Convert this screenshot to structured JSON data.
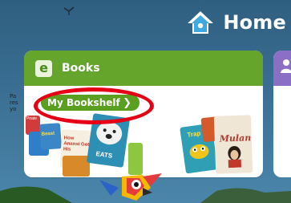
{
  "header": {
    "title": "Home",
    "icon": "home-icon"
  },
  "books_card": {
    "icon_letter": "e",
    "title": "Books",
    "button_label": "My Bookshelf",
    "button_icon": "chevron-right-icon",
    "covers": [
      {
        "title": "Pirate"
      },
      {
        "title": "Beast"
      },
      {
        "title": "How Anansi Got His"
      },
      {
        "title": "EATS"
      },
      {
        "title": "Trap"
      },
      {
        "title": "Mulan"
      }
    ]
  },
  "side_card": {
    "icon": "person-icon",
    "text_lines": [
      "Pa",
      "res",
      "yo"
    ]
  },
  "colors": {
    "green": "#66a52b",
    "button_green": "#5b9f20",
    "purple": "#8b6fc6",
    "highlight_red": "#e50015",
    "home_icon_blue": "#3fa7e1"
  }
}
